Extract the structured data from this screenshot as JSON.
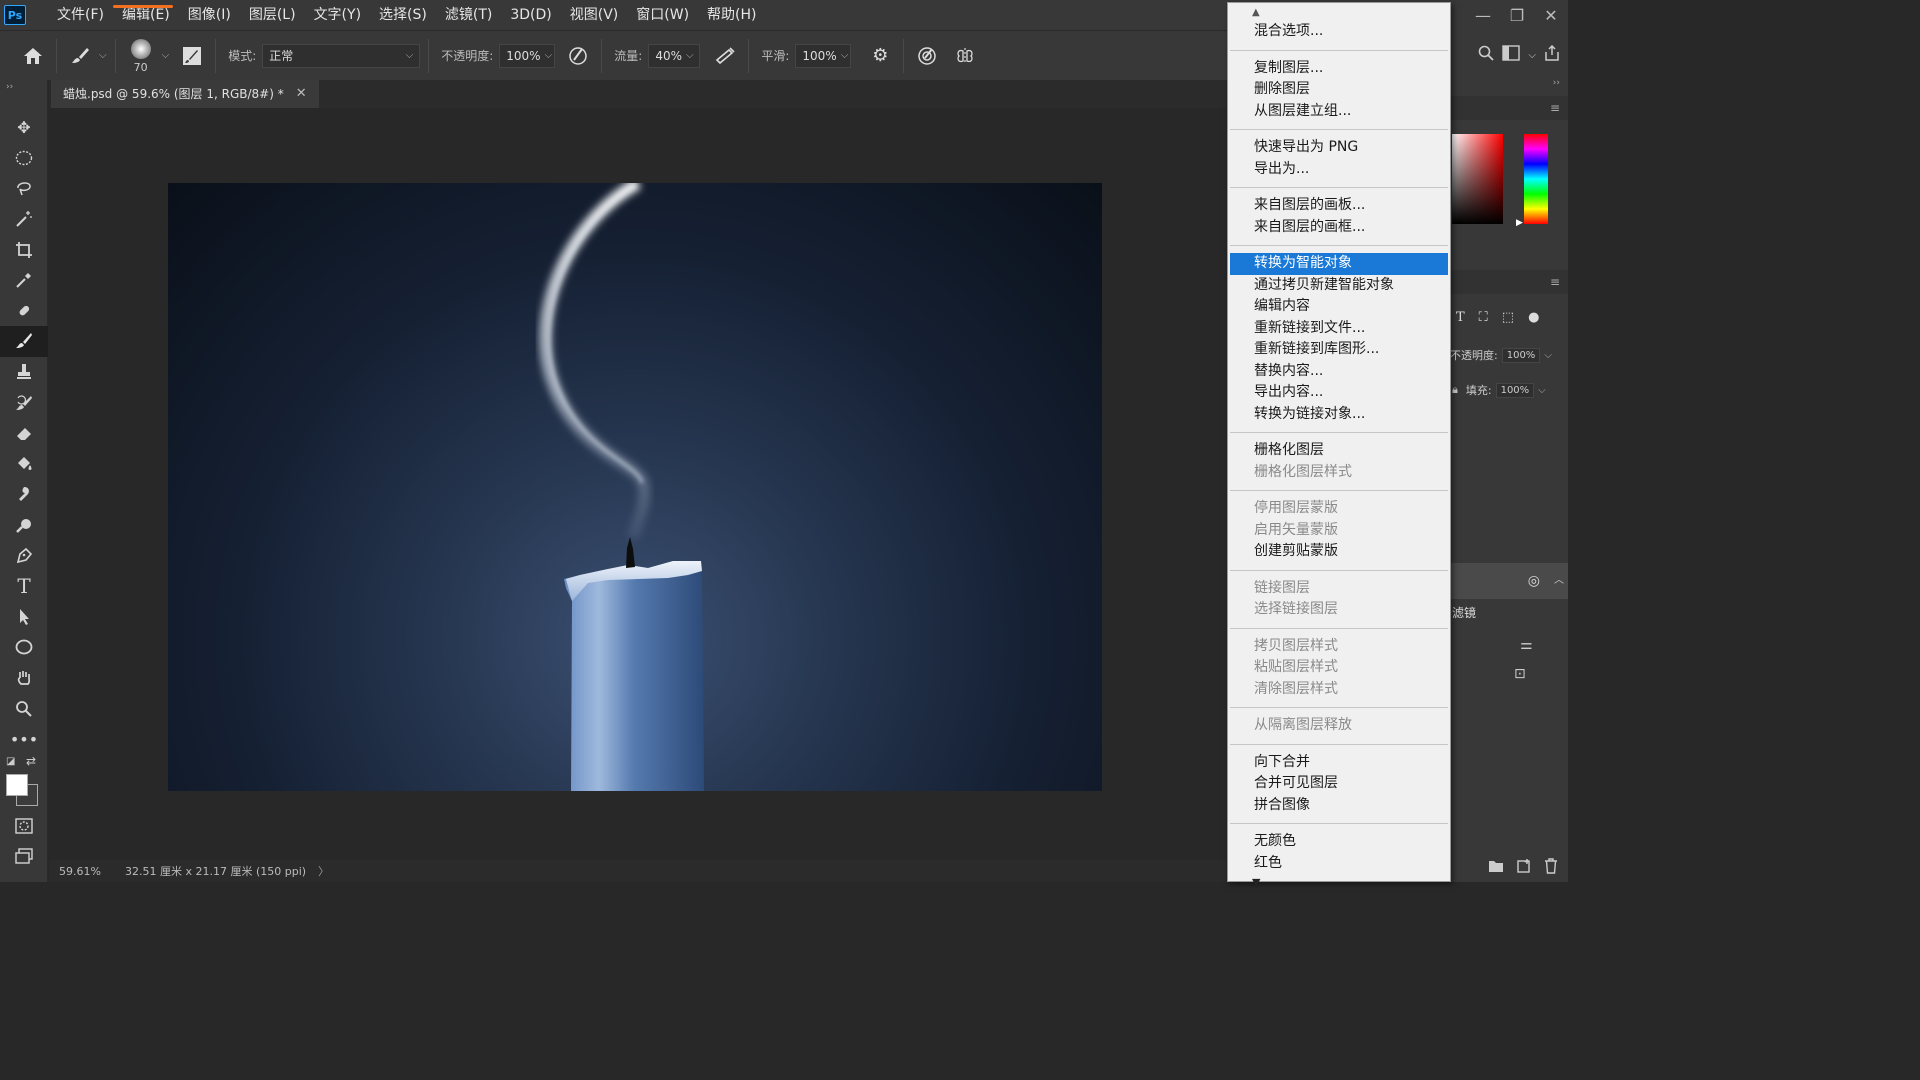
{
  "app": {
    "logo": "Ps"
  },
  "menubar": {
    "items": [
      "文件(F)",
      "编辑(E)",
      "图像(I)",
      "图层(L)",
      "文字(Y)",
      "选择(S)",
      "滤镜(T)",
      "3D(D)",
      "视图(V)",
      "窗口(W)",
      "帮助(H)"
    ]
  },
  "options": {
    "brush_size": "70",
    "mode_label": "模式:",
    "mode_value": "正常",
    "opacity_label": "不透明度:",
    "opacity_value": "100%",
    "flow_label": "流量:",
    "flow_value": "40%",
    "smooth_label": "平滑:",
    "smooth_value": "100%"
  },
  "document": {
    "tab_title": "蜡烛.psd @ 59.6% (图层 1, RGB/8#) *",
    "close_glyph": "✕"
  },
  "status": {
    "zoom": "59.61%",
    "doc_info": "32.51 厘米 x 21.17 厘米 (150 ppi)",
    "arrow": "〉"
  },
  "right_panel": {
    "opacity_label": "不透明度:",
    "opacity_value": "100%",
    "fill_label": "填充:",
    "fill_value": "100%",
    "filter_label": "滤镜"
  },
  "context_menu": {
    "groups": [
      [
        {
          "label": "混合选项...",
          "disabled": false
        }
      ],
      [
        {
          "label": "复制图层...",
          "disabled": false
        },
        {
          "label": "删除图层",
          "disabled": false
        },
        {
          "label": "从图层建立组...",
          "disabled": false
        }
      ],
      [
        {
          "label": "快速导出为 PNG",
          "disabled": false
        },
        {
          "label": "导出为...",
          "disabled": false
        }
      ],
      [
        {
          "label": "来自图层的画板...",
          "disabled": false
        },
        {
          "label": "来自图层的画框...",
          "disabled": false
        }
      ],
      [
        {
          "label": "转换为智能对象",
          "disabled": false,
          "highlight": true
        },
        {
          "label": "通过拷贝新建智能对象",
          "disabled": false
        },
        {
          "label": "编辑内容",
          "disabled": false
        },
        {
          "label": "重新链接到文件...",
          "disabled": false
        },
        {
          "label": "重新链接到库图形...",
          "disabled": false
        },
        {
          "label": "替换内容...",
          "disabled": false
        },
        {
          "label": "导出内容...",
          "disabled": false
        },
        {
          "label": "转换为链接对象...",
          "disabled": false
        }
      ],
      [
        {
          "label": "栅格化图层",
          "disabled": false
        },
        {
          "label": "栅格化图层样式",
          "disabled": true
        }
      ],
      [
        {
          "label": "停用图层蒙版",
          "disabled": true
        },
        {
          "label": "启用矢量蒙版",
          "disabled": true
        },
        {
          "label": "创建剪贴蒙版",
          "disabled": false
        }
      ],
      [
        {
          "label": "链接图层",
          "disabled": true
        },
        {
          "label": "选择链接图层",
          "disabled": true
        }
      ],
      [
        {
          "label": "拷贝图层样式",
          "disabled": true
        },
        {
          "label": "粘贴图层样式",
          "disabled": true
        },
        {
          "label": "清除图层样式",
          "disabled": true
        }
      ],
      [
        {
          "label": "从隔离图层释放",
          "disabled": true
        }
      ],
      [
        {
          "label": "向下合并",
          "disabled": false
        },
        {
          "label": "合并可见图层",
          "disabled": false
        },
        {
          "label": "拼合图像",
          "disabled": false
        }
      ],
      [
        {
          "label": "无颜色",
          "disabled": false
        },
        {
          "label": "红色",
          "disabled": false
        }
      ]
    ]
  },
  "colors": {
    "accent_highlight": "#1a78d6",
    "ps_blue": "#31a8ff",
    "menu_underline": "#f37021"
  }
}
